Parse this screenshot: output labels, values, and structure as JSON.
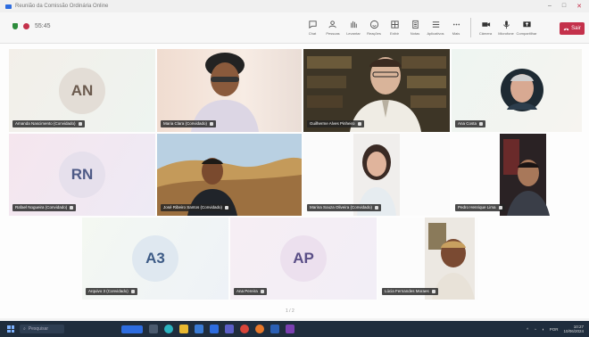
{
  "window": {
    "title": "Reunião da Comissão Ordinária Online"
  },
  "toolbar": {
    "elapsed": "55:45",
    "tools": [
      {
        "label": "Chat",
        "icon": "chat-icon"
      },
      {
        "label": "Pessoas",
        "icon": "people-icon"
      },
      {
        "label": "Levantar",
        "icon": "hand-icon"
      },
      {
        "label": "Reações",
        "icon": "reactions-icon"
      },
      {
        "label": "Exibir",
        "icon": "view-icon"
      },
      {
        "label": "Notas",
        "icon": "notes-icon"
      },
      {
        "label": "Aplicativos",
        "icon": "apps-icon"
      },
      {
        "label": "Mais",
        "icon": "more-icon"
      },
      {
        "label": "Câmera",
        "icon": "camera-icon"
      },
      {
        "label": "Microfone",
        "icon": "mic-icon"
      },
      {
        "label": "Compartilhar",
        "icon": "share-icon"
      }
    ],
    "leave_label": "Sair"
  },
  "participants": [
    {
      "initials": "AN",
      "name": "Amanda Nascimento (Convidado)",
      "bg": "#e3ddd6",
      "fg": "#6b5a4e"
    },
    {
      "name": "Maria Clara (Convidado)"
    },
    {
      "name": "Guilherme Alves Pinheiro"
    },
    {
      "name": "Ana Costa"
    },
    {
      "initials": "RN",
      "name": "Rafael Nogueira (Convidado)",
      "bg": "#e6e0ec",
      "fg": "#4e5a86"
    },
    {
      "name": "José Ribeiro Santos (Convidado)"
    },
    {
      "name": "Marina Souza Oliveira (Convidado)"
    },
    {
      "name": "Pedro Henrique Lima"
    },
    {
      "initials": "A3",
      "name": "Arquivo 3 (Convidado)",
      "bg": "#dfe8f0",
      "fg": "#3d5b86"
    },
    {
      "initials": "AP",
      "name": "Ana Pereira",
      "bg": "#ece0ee",
      "fg": "#5a4e86"
    },
    {
      "name": "Lúcia Fernandes Moraes"
    }
  ],
  "pager": "1 / 2",
  "taskbar": {
    "search_placeholder": "Pesquisar",
    "time": "10:27",
    "date": "10/06/2024",
    "lang": "POR"
  },
  "colors": {
    "leave": "#c4314b",
    "taskbar": "#1f2d3d",
    "accent": "#2d6cdf"
  }
}
